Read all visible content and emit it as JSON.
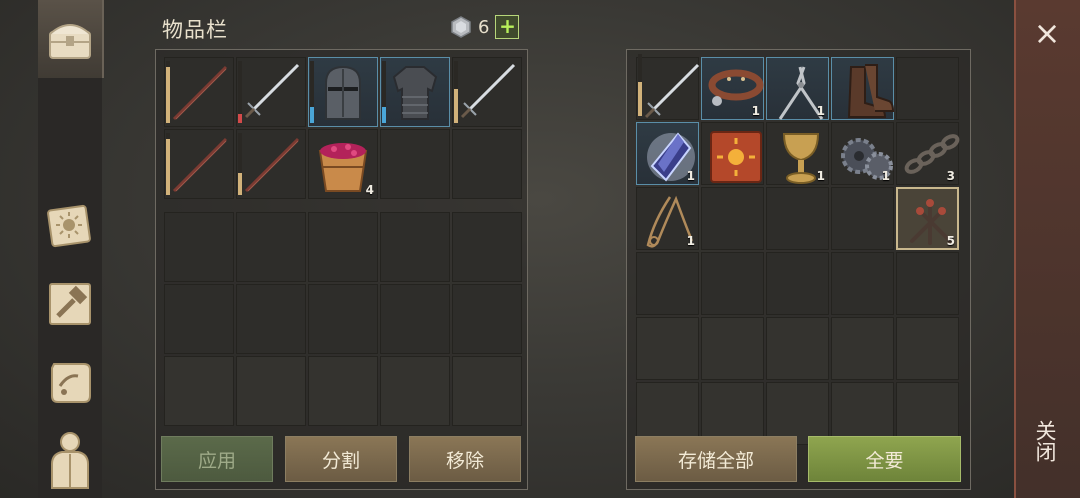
{
  "inventory": {
    "title": "物品栏",
    "gem_count": "6",
    "plus_label": "+"
  },
  "buttons": {
    "apply": "应用",
    "split": "分割",
    "remove": "移除",
    "store_all": "存储全部",
    "take_all": "全要"
  },
  "close": {
    "label": "关闭",
    "symbol": "×"
  },
  "left_items": [
    {
      "name": "spear-icon",
      "qty": "",
      "dura": 0.9,
      "dura_color": "#d2b27a"
    },
    {
      "name": "sword-icon",
      "qty": "",
      "dura": 0.15,
      "dura_color": "#d24a4a"
    },
    {
      "name": "knight-helmet-icon",
      "qty": "",
      "dura": 0.25,
      "dura_color": "#4aa6d8"
    },
    {
      "name": "chest-armor-icon",
      "qty": "",
      "dura": 0.25,
      "dura_color": "#4aa6d8"
    },
    {
      "name": "sword-icon",
      "qty": "",
      "dura": 0.55,
      "dura_color": "#d2b27a"
    },
    {
      "name": "spear-icon",
      "qty": "",
      "dura": 0.9,
      "dura_color": "#d2b27a"
    },
    {
      "name": "spear-icon",
      "qty": "",
      "dura": 0.35,
      "dura_color": "#d2b27a"
    },
    {
      "name": "berry-bucket-icon",
      "qty": "4"
    }
  ],
  "right_items": [
    {
      "name": "sword-icon",
      "qty": "",
      "dura": 0.55,
      "dura_color": "#d2b27a"
    },
    {
      "name": "collar-icon",
      "qty": "1"
    },
    {
      "name": "tongs-icon",
      "qty": "1"
    },
    {
      "name": "boots-icon",
      "qty": ""
    },
    {
      "name": "crystal-icon",
      "qty": "1"
    },
    {
      "name": "sun-book-icon",
      "qty": ""
    },
    {
      "name": "goblet-icon",
      "qty": "1"
    },
    {
      "name": "gears-icon",
      "qty": "1"
    },
    {
      "name": "chain-icon",
      "qty": "3"
    },
    {
      "name": "rope-icon",
      "qty": "1"
    },
    {
      "name": "nails-icon",
      "qty": "5"
    }
  ]
}
